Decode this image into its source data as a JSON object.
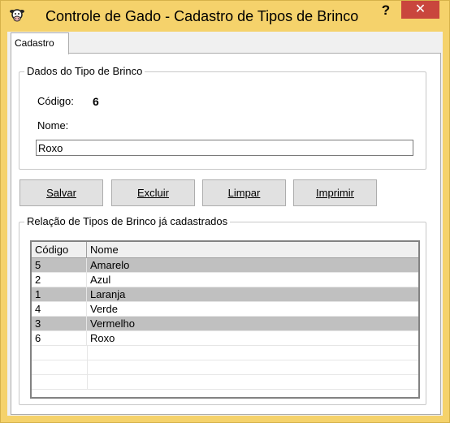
{
  "window": {
    "title": "Controle de Gado - Cadastro de Tipos de Brinco",
    "help_label": "?",
    "close_label": "✕"
  },
  "tabs": [
    {
      "label": "Cadastro"
    }
  ],
  "details_group": {
    "title": "Dados do Tipo de Brinco",
    "code_label": "Código:",
    "code_value": "6",
    "name_label": "Nome:",
    "name_value": "Roxo"
  },
  "buttons": {
    "save_label": "Salvar",
    "delete_label": "Excluir",
    "clear_label": "Limpar",
    "print_label": "Imprimir"
  },
  "list_group": {
    "title": "Relação de Tipos de Brinco já cadastrados",
    "columns": [
      "Código",
      "Nome"
    ],
    "rows": [
      {
        "code": "5",
        "name": "Amarelo",
        "selected": true
      },
      {
        "code": "2",
        "name": "Azul",
        "selected": false
      },
      {
        "code": "1",
        "name": "Laranja",
        "selected": true
      },
      {
        "code": "4",
        "name": "Verde",
        "selected": false
      },
      {
        "code": "3",
        "name": "Vermelho",
        "selected": true
      },
      {
        "code": "6",
        "name": "Roxo",
        "selected": false
      }
    ]
  },
  "colors": {
    "titlebar": "#f5d26b",
    "close_button": "#c9463d",
    "selected_row": "#c0c0c0"
  }
}
